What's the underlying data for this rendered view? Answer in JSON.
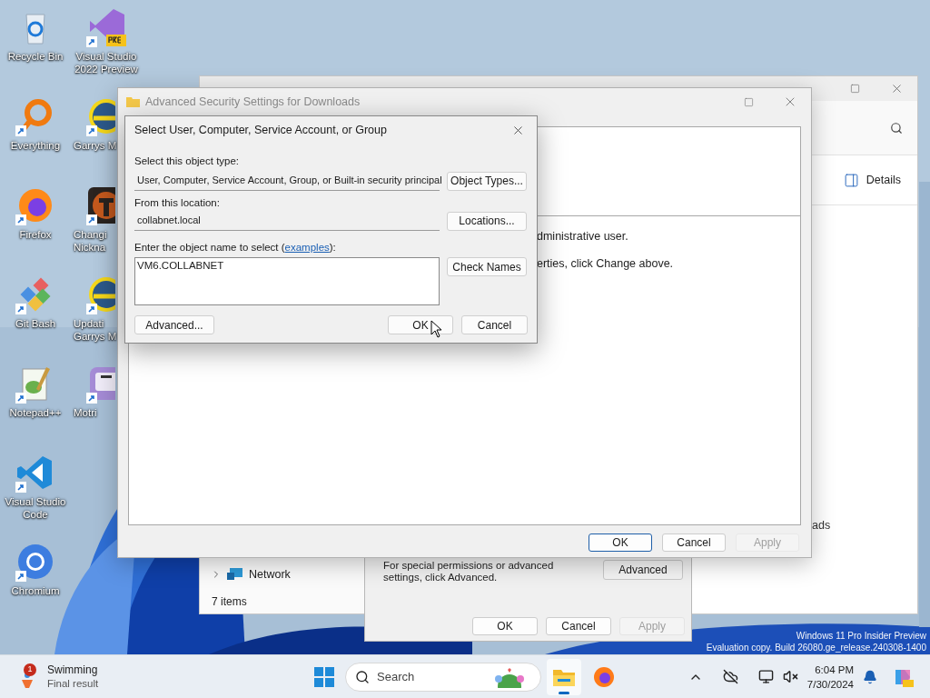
{
  "desktop_icons": {
    "column_1": [
      {
        "label": "Recycle Bin",
        "kind": "recycle",
        "shortcut": false
      },
      {
        "label": "Everything",
        "kind": "everything",
        "shortcut": true
      },
      {
        "label": "Firefox",
        "kind": "firefox",
        "shortcut": true
      },
      {
        "label": "Git Bash",
        "kind": "git",
        "shortcut": true
      },
      {
        "label": "Notepad++",
        "kind": "notepad",
        "shortcut": true
      },
      {
        "label": "Visual Studio Code",
        "kind": "vscode",
        "shortcut": true
      },
      {
        "label": "Chromium",
        "kind": "chromium",
        "shortcut": true
      }
    ],
    "column_2": [
      {
        "label": "Visual Studio 2022 Preview",
        "kind": "vs",
        "shortcut": true
      },
      {
        "label": "Garrys M",
        "kind": "gmod",
        "shortcut": true
      },
      {
        "label": "Changi Nickna",
        "kind": "tf",
        "shortcut": true
      },
      {
        "label": "Updati Garrys M",
        "kind": "gmod",
        "shortcut": true
      },
      {
        "label": "Motri",
        "kind": "motrix",
        "shortcut": true
      }
    ]
  },
  "explorer_window": {
    "details_button": "Details",
    "content_text": "ads",
    "nav_items": [
      {
        "label": "Network",
        "expanded": false
      }
    ],
    "status": "7 items"
  },
  "properties_dialog": {
    "advanced_text": "For special permissions or advanced settings, click Advanced.",
    "advanced_button": "Advanced",
    "buttons": [
      {
        "label": "OK",
        "disabled": false
      },
      {
        "label": "Cancel",
        "disabled": false
      },
      {
        "label": "Apply",
        "disabled": true
      }
    ]
  },
  "security_window": {
    "title": "Advanced Security Settings for Downloads",
    "active": false,
    "texts": [
      "dministrative user.",
      "erties, click Change above."
    ],
    "buttons": [
      {
        "label": "OK",
        "default": true,
        "disabled": false
      },
      {
        "label": "Cancel",
        "default": false,
        "disabled": false
      },
      {
        "label": "Apply",
        "default": false,
        "disabled": true
      }
    ]
  },
  "select_dialog": {
    "title": "Select User, Computer, Service Account, or Group",
    "object_type_label": "Select this object type:",
    "object_type": "User, Computer, Service Account, Group, or Built-in security principal",
    "object_types_button": "Object Types...",
    "location_label": "From this location:",
    "location": "collabnet.local",
    "locations_button": "Locations...",
    "name_label": {
      "before": "Enter the object name to select (",
      "link": "examples",
      "after": "):"
    },
    "name_value": "VM6.COLLABNET",
    "check_names_button": "Check Names",
    "advanced_button": "Advanced...",
    "ok_button": "OK",
    "cancel_button": "Cancel"
  },
  "watermark": [
    "Windows 11 Pro Insider Preview",
    "Evaluation copy. Build 26080.ge_release.240308-1400"
  ],
  "taskbar": {
    "widget": {
      "title": "Swimming",
      "subtitle": "Final result",
      "badge": "1"
    },
    "search_label": "Search",
    "apps": [
      {
        "kind": "explorer",
        "active": true
      },
      {
        "kind": "firefox",
        "active": false
      }
    ],
    "time": "6:04 PM",
    "date": "7/30/2024"
  }
}
